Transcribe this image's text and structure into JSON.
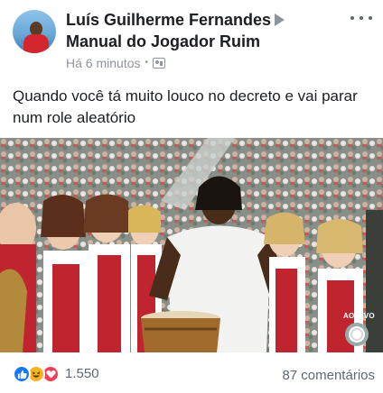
{
  "post": {
    "author": "Luís Guilherme Fernandes",
    "page": "Manual do Jogador Ruim",
    "timestamp": "Há 6 minutos",
    "separator": "•",
    "text": "Quando você tá muito louco no decreto e vai parar num role aleatório"
  },
  "photo": {
    "live_badge": "AO VIVO",
    "network_logo_icon": "globo-logo-icon"
  },
  "footer": {
    "reaction_count": "1.550",
    "comments": "87 comentários",
    "reactions": [
      "like-icon",
      "haha-icon",
      "love-icon"
    ]
  },
  "colors": {
    "like": "#1877f2",
    "haha": "#f7b125",
    "love": "#f33e58",
    "meta_text": "#90949c"
  }
}
